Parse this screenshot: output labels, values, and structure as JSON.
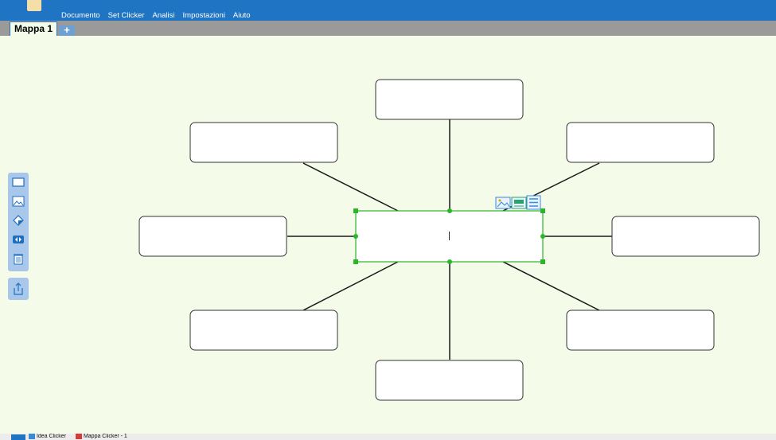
{
  "menubar": {
    "items": [
      "Documento",
      "Set Clicker",
      "Analisi",
      "Impostazioni",
      "Aiuto"
    ]
  },
  "tabs": {
    "active_label": "Mappa 1",
    "add_label": "+"
  },
  "sidebar_tools": [
    "rectangle-icon",
    "image-icon",
    "fill-icon",
    "swap-icon",
    "trash-icon",
    "export-icon"
  ],
  "edit_icons": [
    "image-icon",
    "keyboard-icon",
    "list-icon"
  ],
  "map": {
    "center_text": "",
    "boxes": [
      "",
      "",
      "",
      "",
      "",
      "",
      "",
      ""
    ]
  },
  "taskbar": {
    "items": [
      "Idea Clicker",
      "Mappa Clicker - 1"
    ]
  },
  "colors": {
    "menubar": "#1f74c4",
    "canvas": "#f4fbe8",
    "selection": "#2bb52b",
    "toolbar": "#a9c7ea"
  }
}
